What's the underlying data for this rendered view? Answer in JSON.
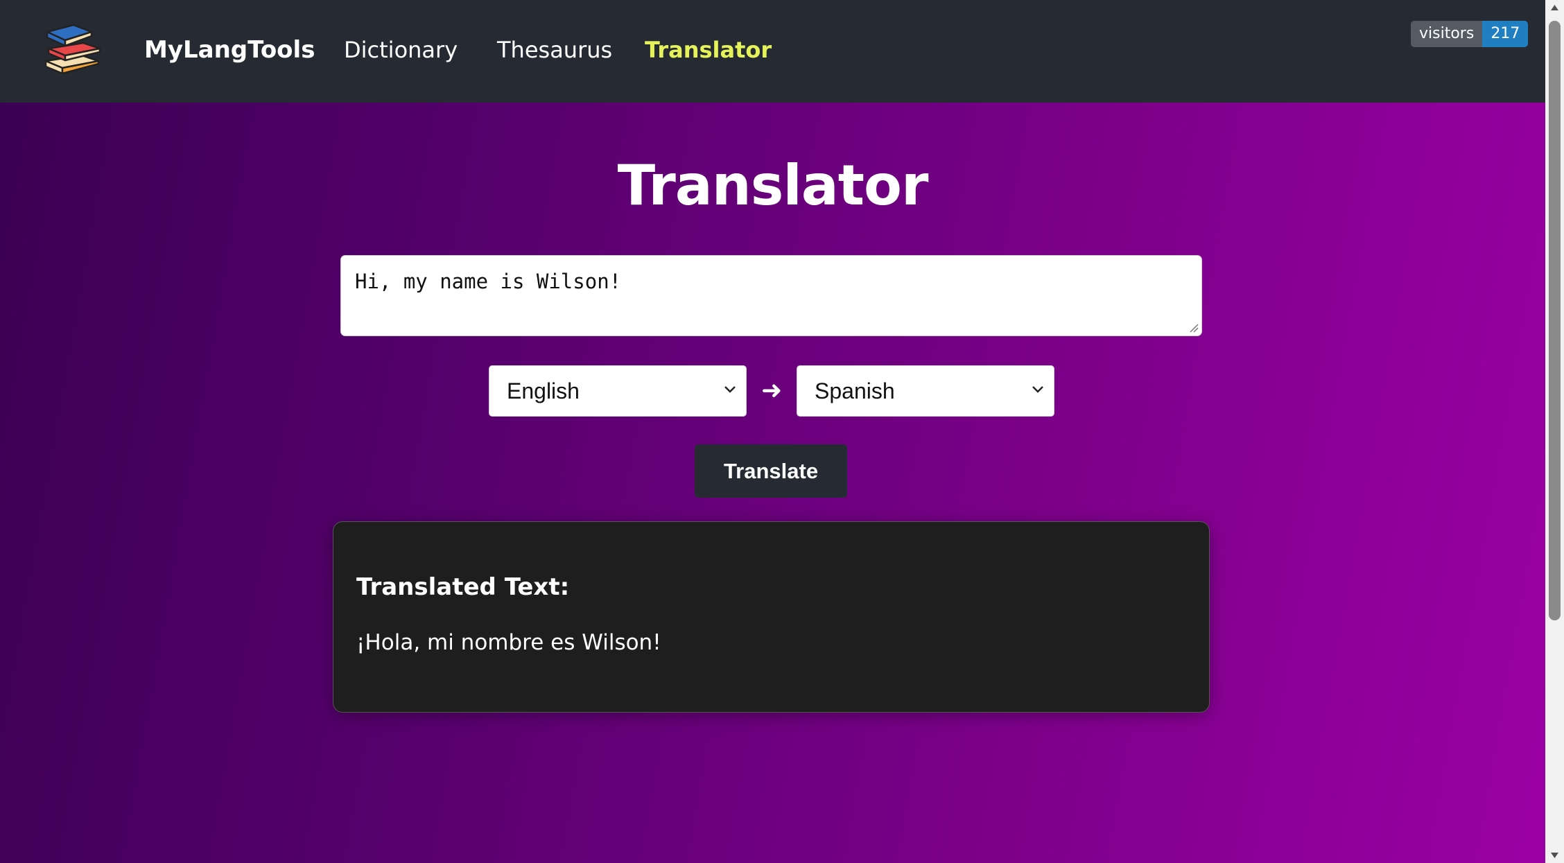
{
  "navbar": {
    "brand": "MyLangTools",
    "links": [
      {
        "label": "Dictionary",
        "active": false
      },
      {
        "label": "Thesaurus",
        "active": false
      },
      {
        "label": "Translator",
        "active": true
      }
    ],
    "visitors": {
      "label": "visitors",
      "count": "217"
    }
  },
  "main": {
    "title": "Translator",
    "input_text": "Hi, my name is Wilson!",
    "source_language": "English",
    "target_language": "Spanish",
    "arrow": "➜",
    "translate_button": "Translate",
    "result": {
      "heading": "Translated Text:",
      "text": "¡Hola, mi nombre es Wilson!"
    }
  },
  "colors": {
    "navbar_bg": "#262b33",
    "active_link": "#e6f25a",
    "gradient_start": "#3a0052",
    "gradient_end": "#9b00a4",
    "badge_count_bg": "#1f7fc0",
    "card_bg": "#1e1e1e"
  }
}
